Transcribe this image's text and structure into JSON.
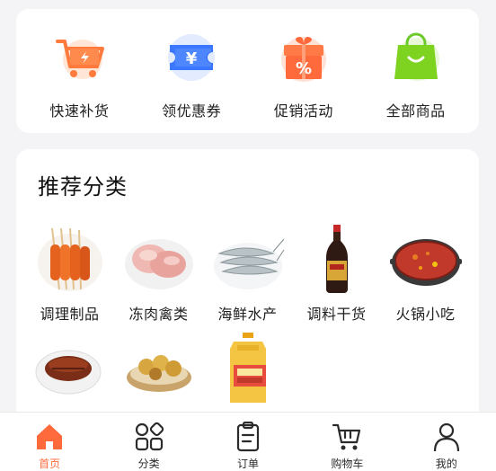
{
  "quick_actions": [
    {
      "label": "快速补货",
      "icon": "cart-bolt-icon"
    },
    {
      "label": "领优惠券",
      "icon": "coupon-icon"
    },
    {
      "label": "促销活动",
      "icon": "gift-percent-icon"
    },
    {
      "label": "全部商品",
      "icon": "shopping-bag-icon"
    }
  ],
  "recommend": {
    "title": "推荐分类",
    "categories": [
      {
        "label": "调理制品",
        "image": "skewers-image"
      },
      {
        "label": "冻肉禽类",
        "image": "frozen-poultry-image"
      },
      {
        "label": "海鲜水产",
        "image": "shrimp-image"
      },
      {
        "label": "调料干货",
        "image": "soy-sauce-bottle-image"
      },
      {
        "label": "火锅小吃",
        "image": "hotpot-image"
      },
      {
        "label": "",
        "image": "braised-pork-image"
      },
      {
        "label": "",
        "image": "buns-image"
      },
      {
        "label": "",
        "image": "cooking-oil-image"
      }
    ]
  },
  "tabbar": {
    "active_color": "#ff6a3d",
    "items": [
      {
        "label": "首页",
        "icon": "home-icon",
        "active": true
      },
      {
        "label": "分类",
        "icon": "category-grid-icon",
        "active": false
      },
      {
        "label": "订单",
        "icon": "order-clipboard-icon",
        "active": false
      },
      {
        "label": "购物车",
        "icon": "cart-icon",
        "active": false
      },
      {
        "label": "我的",
        "icon": "user-icon",
        "active": false
      }
    ]
  }
}
